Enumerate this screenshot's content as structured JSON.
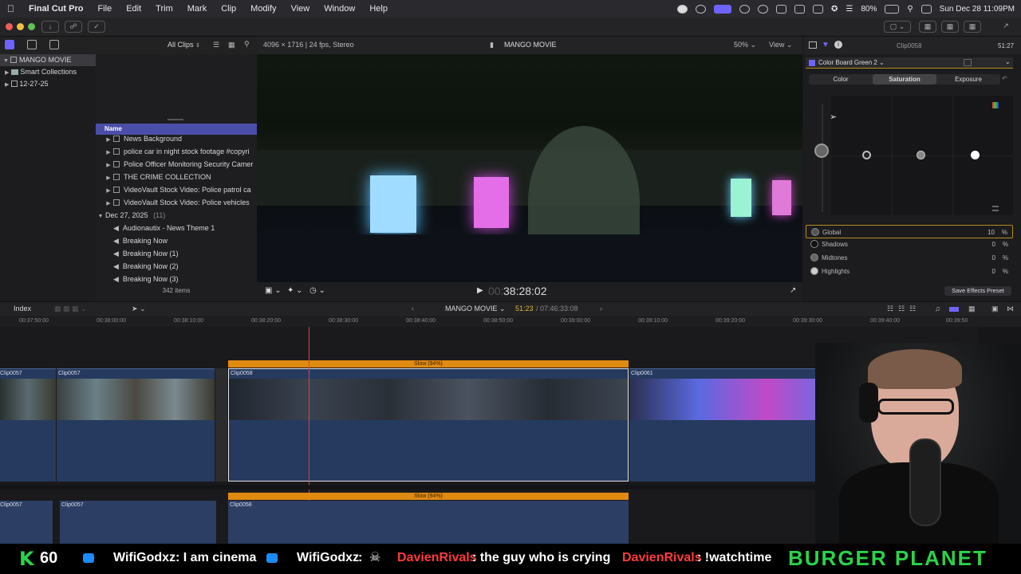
{
  "menubar": {
    "app": "Final Cut Pro",
    "items": [
      "File",
      "Edit",
      "Trim",
      "Mark",
      "Clip",
      "Modify",
      "View",
      "Window",
      "Help"
    ],
    "battery": "80%",
    "datetime": "Sun Dec 28  11:09PM"
  },
  "libraries": {
    "items": [
      {
        "label": "MANGO MOVIE",
        "selected": true
      },
      {
        "label": "Smart Collections",
        "selected": false
      },
      {
        "label": "12-27-25",
        "selected": false
      }
    ]
  },
  "browser": {
    "filter": "All Clips",
    "name_header": "Name",
    "rows": [
      {
        "label": "News Background",
        "type": "clip"
      },
      {
        "label": "police  car in night stock footage #copyri",
        "type": "clip"
      },
      {
        "label": "Police Officer Monitoring Security Camer",
        "type": "clip"
      },
      {
        "label": "THE CRIME COLLECTION",
        "type": "clip"
      },
      {
        "label": "VideoVault Stock Video:   Police patrol ca",
        "type": "clip"
      },
      {
        "label": "VideoVault Stock Video:   Police vehicles",
        "type": "clip"
      }
    ],
    "group": {
      "label": "Dec 27, 2025",
      "count": "(11)"
    },
    "group_rows": [
      "Audionautix - News Theme 1",
      "Breaking Now",
      "Breaking Now (1)",
      "Breaking Now (2)",
      "Breaking Now (3)"
    ],
    "item_count": "342 items"
  },
  "viewer": {
    "format": "4096 × 1716 | 24 fps, Stereo",
    "title": "MANGO MOVIE",
    "zoom": "50%",
    "view": "View",
    "timecode_dim": "00:",
    "timecode": "38:28:02"
  },
  "inspector": {
    "clip": "Clip0058",
    "duration": "51:27",
    "effect": "Color Board Green 2",
    "tabs": [
      "Color",
      "Saturation",
      "Exposure"
    ],
    "active_tab": "Saturation",
    "params": [
      {
        "label": "Global",
        "value": "10",
        "unit": "%"
      },
      {
        "label": "Shadows",
        "value": "0",
        "unit": "%"
      },
      {
        "label": "Midtones",
        "value": "0",
        "unit": "%"
      },
      {
        "label": "Highlights",
        "value": "0",
        "unit": "%"
      }
    ],
    "save_preset": "Save Effects Preset"
  },
  "timeline": {
    "index": "Index",
    "project": "MANGO MOVIE",
    "position": "51:23",
    "total": "07:46:33:08",
    "ruler": [
      "00:37:50:00",
      "00:38:00:00",
      "00:38:10:00",
      "00:38:20:00",
      "00:38:30:00",
      "00:38:40:00",
      "00:38:50:00",
      "00:39:00:00",
      "00:39:10:00",
      "00:39:20:00",
      "00:39:30:00",
      "00:39:40:00",
      "00:39:50"
    ],
    "clips": {
      "a": "Clip0057",
      "b": "Clip0057",
      "c": "Clip0058",
      "d": "Clip0061"
    },
    "retime_label": "Slow (94%)",
    "audio": {
      "a": "Clip0057",
      "b": "Clip0057",
      "c": "Clip0058"
    }
  },
  "overlay": {
    "k_count": "60",
    "chat": [
      {
        "user": "WifiGodxz",
        "msg": ": I am cinema",
        "color": "#ffffff"
      },
      {
        "user": "WifiGodxz",
        "msg": ":",
        "color": "#ffffff"
      },
      {
        "user": "DavienRivals",
        "msg": ": the guy who is crying",
        "color": "#ff3a3a"
      },
      {
        "user": "DavienRivals",
        "msg": ": !watchtime",
        "color": "#ff3a3a"
      }
    ],
    "sponsor": "BURGER PLANET"
  }
}
